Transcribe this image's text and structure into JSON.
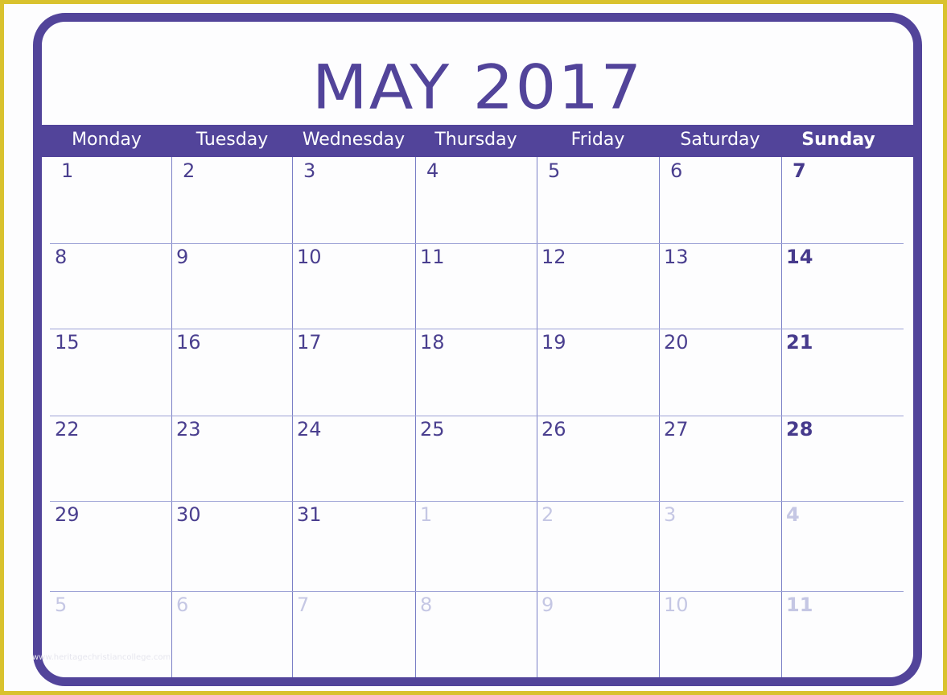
{
  "calendar": {
    "title": "MAY 2017",
    "month": "May",
    "year": 2017,
    "colors": {
      "accent": "#52449a",
      "frame": "#d9c22e",
      "grid_line": "#7a7fc6",
      "current_month_number": "#4a3f8f",
      "other_month_number": "#c5c7e4",
      "header_text": "#ffffff"
    },
    "weekdays": [
      "Monday",
      "Tuesday",
      "Wednesday",
      "Thursday",
      "Friday",
      "Saturday",
      "Sunday"
    ],
    "weeks": [
      [
        {
          "d": "1",
          "m": "cur"
        },
        {
          "d": "2",
          "m": "cur"
        },
        {
          "d": "3",
          "m": "cur"
        },
        {
          "d": "4",
          "m": "cur"
        },
        {
          "d": "5",
          "m": "cur"
        },
        {
          "d": "6",
          "m": "cur"
        },
        {
          "d": "7",
          "m": "cur"
        }
      ],
      [
        {
          "d": "8",
          "m": "cur"
        },
        {
          "d": "9",
          "m": "cur"
        },
        {
          "d": "10",
          "m": "cur"
        },
        {
          "d": "11",
          "m": "cur"
        },
        {
          "d": "12",
          "m": "cur"
        },
        {
          "d": "13",
          "m": "cur"
        },
        {
          "d": "14",
          "m": "cur"
        }
      ],
      [
        {
          "d": "15",
          "m": "cur"
        },
        {
          "d": "16",
          "m": "cur"
        },
        {
          "d": "17",
          "m": "cur"
        },
        {
          "d": "18",
          "m": "cur"
        },
        {
          "d": "19",
          "m": "cur"
        },
        {
          "d": "20",
          "m": "cur"
        },
        {
          "d": "21",
          "m": "cur"
        }
      ],
      [
        {
          "d": "22",
          "m": "cur"
        },
        {
          "d": "23",
          "m": "cur"
        },
        {
          "d": "24",
          "m": "cur"
        },
        {
          "d": "25",
          "m": "cur"
        },
        {
          "d": "26",
          "m": "cur"
        },
        {
          "d": "27",
          "m": "cur"
        },
        {
          "d": "28",
          "m": "cur"
        }
      ],
      [
        {
          "d": "29",
          "m": "cur"
        },
        {
          "d": "30",
          "m": "cur"
        },
        {
          "d": "31",
          "m": "cur"
        },
        {
          "d": "1",
          "m": "next"
        },
        {
          "d": "2",
          "m": "next"
        },
        {
          "d": "3",
          "m": "next"
        },
        {
          "d": "4",
          "m": "next"
        }
      ],
      [
        {
          "d": "5",
          "m": "next"
        },
        {
          "d": "6",
          "m": "next"
        },
        {
          "d": "7",
          "m": "next"
        },
        {
          "d": "8",
          "m": "next"
        },
        {
          "d": "9",
          "m": "next"
        },
        {
          "d": "10",
          "m": "next"
        },
        {
          "d": "11",
          "m": "next"
        }
      ]
    ]
  },
  "watermark": "www.heritagechristiancollege.com"
}
